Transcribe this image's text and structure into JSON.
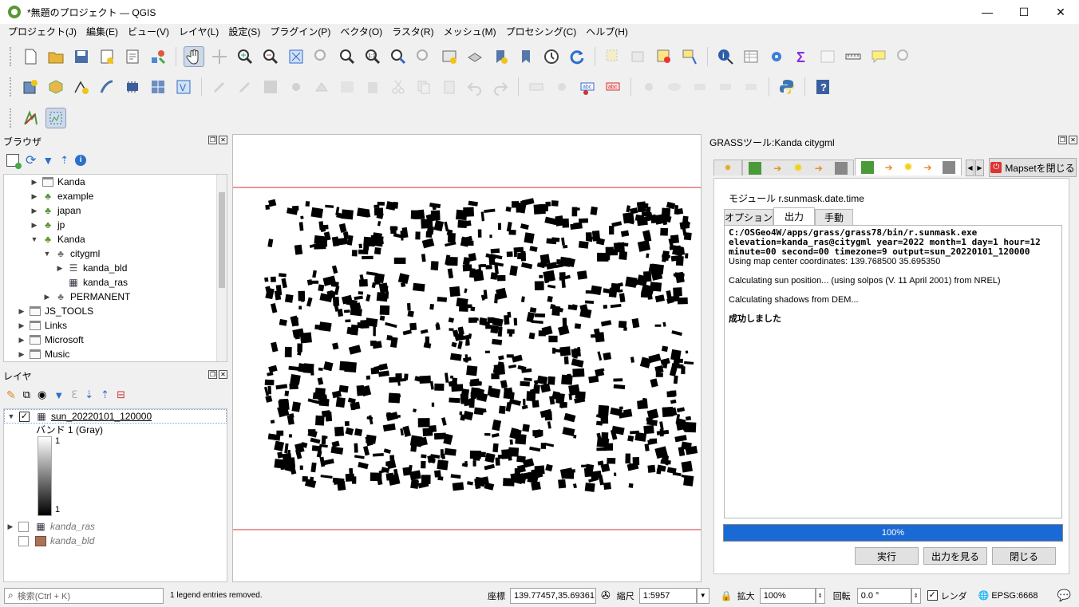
{
  "window": {
    "title": "*無題のプロジェクト — QGIS",
    "minimize": "—",
    "maximize": "☐",
    "close": "✕"
  },
  "menu": [
    "プロジェクト(J)",
    "編集(E)",
    "ビュー(V)",
    "レイヤ(L)",
    "設定(S)",
    "プラグイン(P)",
    "ベクタ(O)",
    "ラスタ(R)",
    "メッシュ(M)",
    "プロセシング(C)",
    "ヘルプ(H)"
  ],
  "browser": {
    "title": "ブラウザ",
    "items": [
      "Kanda",
      "example",
      "japan",
      "jp",
      "Kanda",
      "citygml",
      "kanda_bld",
      "kanda_ras",
      "PERMANENT",
      "JS_TOOLS",
      "Links",
      "Microsoft",
      "Music"
    ]
  },
  "layers": {
    "title": "レイヤ",
    "items": [
      {
        "name": "sun_20220101_120000",
        "checked": true
      },
      {
        "name": "kanda_ras",
        "checked": false
      },
      {
        "name": "kanda_bld",
        "checked": false
      }
    ],
    "band_label": "バンド 1 (Gray)",
    "legend_max": "1",
    "legend_min": "1",
    "bld_color": "#a9735a"
  },
  "grass": {
    "title": "GRASSツール:Kanda citygml",
    "close_mapset": "Mapsetを閉じる",
    "module": "モジュール r.sunmask.date.time",
    "tabs": [
      "オプション",
      "出力",
      "手動"
    ],
    "output_lines": [
      {
        "text": "C:/OSGeo4W/apps/grass/grass78/bin/r.sunmask.exe",
        "mono": true
      },
      {
        "text": "elevation=kanda_ras@citygml year=2022 month=1 day=1 hour=12",
        "mono": true
      },
      {
        "text": "minute=00 second=00 timezone=9 output=sun_20220101_120000",
        "mono": true
      },
      {
        "text": "Using map center coordinates: 139.768500 35.695350",
        "mono": false
      },
      {
        "text": "",
        "mono": false
      },
      {
        "text": "Calculating sun position... (using solpos (V. 11 April 2001) from NREL)",
        "mono": false
      },
      {
        "text": "",
        "mono": false
      },
      {
        "text": "Calculating shadows from DEM...",
        "mono": false
      },
      {
        "text": "",
        "mono": false
      },
      {
        "text": "成功しました",
        "mono": false,
        "bold": true
      }
    ],
    "progress": 100,
    "progress_label": "100%",
    "buttons": {
      "run": "実行",
      "view": "出力を見る",
      "close": "閉じる"
    }
  },
  "status": {
    "search_placeholder": "検索(Ctrl + K)",
    "message": "1 legend entries removed.",
    "coord_label": "座標",
    "coord_value": "139.77457,35.69361",
    "scale_label": "縮尺",
    "scale_value": "1:5957",
    "zoom_label": "拡大",
    "zoom_value": "100%",
    "rotation_label": "回転",
    "rotation_value": "0.0 °",
    "render_label": "レンダ",
    "crs": "EPSG:6668"
  }
}
